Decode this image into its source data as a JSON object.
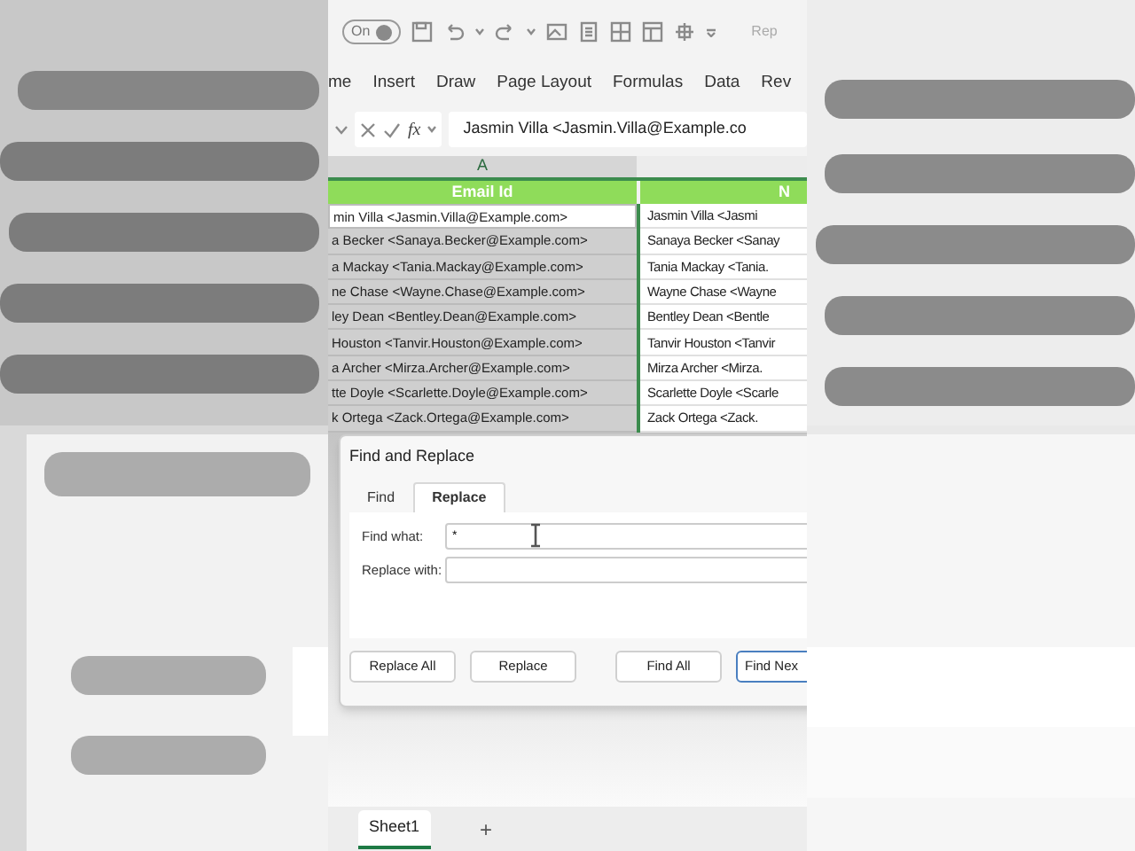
{
  "quick_access": {
    "autosave_label": "On",
    "autosave_on": true,
    "search_text": "Rep"
  },
  "ribbon_tabs": [
    {
      "label": "me"
    },
    {
      "label": "Insert"
    },
    {
      "label": "Draw"
    },
    {
      "label": "Page Layout"
    },
    {
      "label": "Formulas"
    },
    {
      "label": "Data"
    },
    {
      "label": "Rev"
    }
  ],
  "formula_bar": {
    "fx": "fx",
    "value": "Jasmin Villa <Jasmin.Villa@Example.co"
  },
  "sheet": {
    "column_headers": [
      "A"
    ],
    "header_cells": [
      "Email Id",
      "N"
    ],
    "rows": [
      {
        "email": "min Villa <Jasmin.Villa@Example.com>",
        "column_2": "Jasmin Villa <Jasmi",
        "selected": true,
        "active": true
      },
      {
        "email": "a Becker <Sanaya.Becker@Example.com>",
        "column_2": "Sanaya Becker <Sanay",
        "selected": true,
        "active": false
      },
      {
        "email": "a Mackay <Tania.Mackay@Example.com>",
        "column_2": "Tania Mackay <Tania.",
        "selected": true,
        "active": false
      },
      {
        "email": "ne Chase <Wayne.Chase@Example.com>",
        "column_2": "Wayne Chase <Wayne",
        "selected": true,
        "active": false
      },
      {
        "email": "ley Dean <Bentley.Dean@Example.com>",
        "column_2": "Bentley Dean <Bentle",
        "selected": true,
        "active": false
      },
      {
        "email": "Houston <Tanvir.Houston@Example.com>",
        "column_2": "Tanvir Houston <Tanvir",
        "selected": true,
        "active": false
      },
      {
        "email": "a Archer <Mirza.Archer@Example.com>",
        "column_2": "Mirza Archer <Mirza.",
        "selected": true,
        "active": false
      },
      {
        "email": "tte Doyle <Scarlette.Doyle@Example.com>",
        "column_2": "Scarlette Doyle <Scarle",
        "selected": true,
        "active": false
      },
      {
        "email": "k Ortega <Zack.Ortega@Example.com>",
        "column_2": "Zack Ortega <Zack.",
        "selected": true,
        "active": false
      }
    ]
  },
  "dialog": {
    "title": "Find and Replace",
    "tabs": [
      {
        "label": "Find",
        "selected": false
      },
      {
        "label": "Replace",
        "selected": true
      }
    ],
    "fields": [
      {
        "label": "Find what:",
        "value": "*"
      },
      {
        "label": "Replace with:"
      }
    ],
    "buttons": [
      {
        "label": "Replace All",
        "default": false
      },
      {
        "label": "Replace",
        "default": false
      },
      {
        "label": "Find All",
        "default": false
      },
      {
        "label": "Find Nex",
        "default": true
      }
    ]
  },
  "sheet_tabs": [
    {
      "label": "Sheet1",
      "selected": true
    }
  ],
  "add_sheet": "+"
}
